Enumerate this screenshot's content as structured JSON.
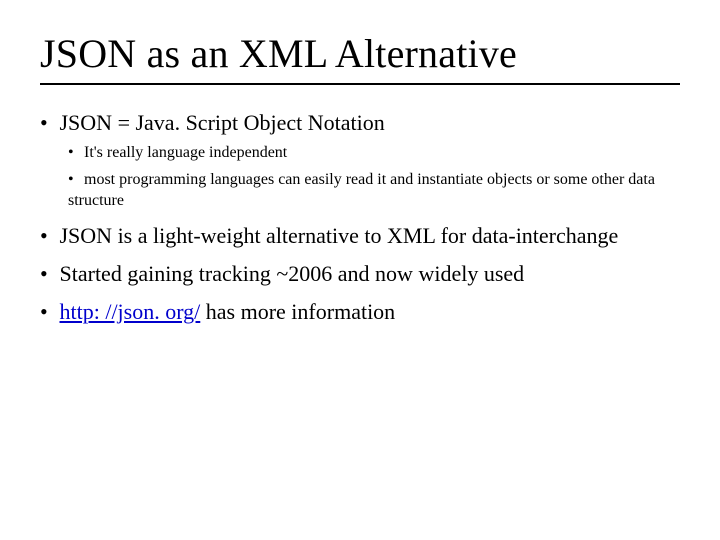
{
  "title": "JSON as an XML Alternative",
  "bullets": {
    "b1": "JSON = Java. Script Object Notation",
    "b1a": "It's really language independent",
    "b1b": "most programming languages can easily read it and instantiate objects or some other data structure",
    "b2": "JSON is a light-weight alternative to XML for data-interchange",
    "b3": "Started gaining tracking ~2006 and now widely used",
    "b4_link": "http: //json. org/",
    "b4_rest": " has more information"
  }
}
